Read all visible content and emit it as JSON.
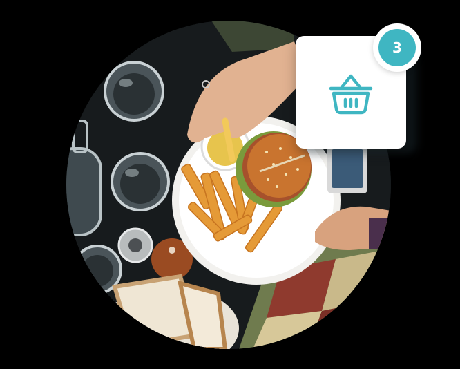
{
  "cart": {
    "item_count": "3",
    "icon": "shopping-basket-icon",
    "accent_color": "#3fb6c2"
  },
  "photo": {
    "subject": "food-photo"
  },
  "colors": {
    "background": "#000000",
    "card": "#ffffff",
    "badge": "#3fb6c2"
  }
}
